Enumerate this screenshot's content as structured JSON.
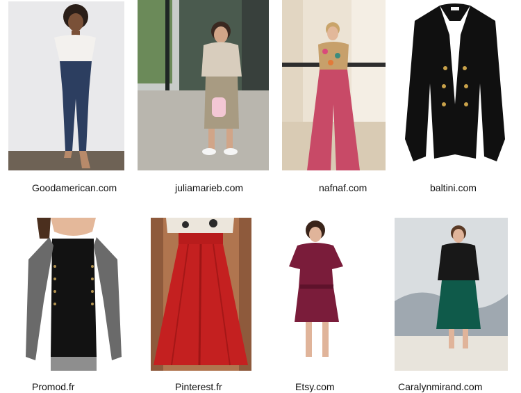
{
  "row1": [
    {
      "source": "Goodamerican.com"
    },
    {
      "source": "juliamarieb.com"
    },
    {
      "source": "nafnaf.com"
    },
    {
      "source": "baltini.com"
    }
  ],
  "row2": [
    {
      "source": "Promod.fr"
    },
    {
      "source": "Pinterest.fr"
    },
    {
      "source": "Etsy.com"
    },
    {
      "source": "Caralynmirand.com"
    }
  ]
}
